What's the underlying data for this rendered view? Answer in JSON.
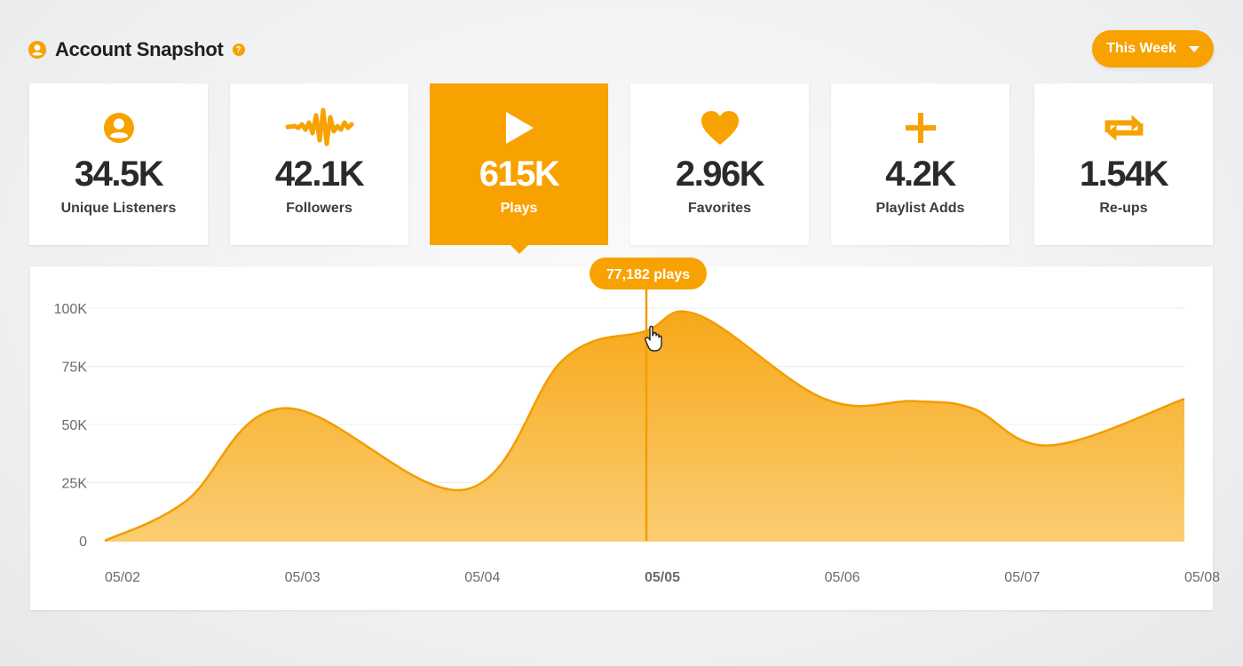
{
  "header": {
    "title": "Account Snapshot",
    "help_icon": "?",
    "icon": "account-circle-icon"
  },
  "period": {
    "label": "This Week",
    "icon": "caret-down-icon"
  },
  "stats": [
    {
      "icon": "user-circle-icon",
      "value": "34.5K",
      "label": "Unique Listeners",
      "active": false
    },
    {
      "icon": "audiomack-wave-icon",
      "value": "42.1K",
      "label": "Followers",
      "active": false
    },
    {
      "icon": "play-icon",
      "value": "615K",
      "label": "Plays",
      "active": true
    },
    {
      "icon": "heart-icon",
      "value": "2.96K",
      "label": "Favorites",
      "active": false
    },
    {
      "icon": "plus-icon",
      "value": "4.2K",
      "label": "Playlist Adds",
      "active": false
    },
    {
      "icon": "repost-icon",
      "value": "1.54K",
      "label": "Re-ups",
      "active": false
    }
  ],
  "colors": {
    "accent": "#f7a200",
    "area_top": "#f7a81a",
    "area_bottom": "#fbcd72",
    "grid": "#ececec"
  },
  "chart_data": {
    "type": "area",
    "categories": [
      "05/02",
      "05/03",
      "05/04",
      "05/05",
      "05/06",
      "05/07",
      "05/08"
    ],
    "y_ticks": [
      "0",
      "25K",
      "50K",
      "75K",
      "100K"
    ],
    "ylim": [
      0,
      100000
    ],
    "series": [
      {
        "values": [
          0,
          57000,
          22000,
          84000,
          61000,
          58000,
          61000
        ],
        "detail_points": [
          [
            0.0,
            0
          ],
          [
            0.45,
            17000
          ],
          [
            1.0,
            57000
          ],
          [
            2.0,
            22000
          ],
          [
            2.55,
            78000
          ],
          [
            3.0,
            90000
          ],
          [
            3.3,
            97000
          ],
          [
            4.0,
            61000
          ],
          [
            4.5,
            60000
          ],
          [
            4.82,
            57000
          ],
          [
            5.25,
            41000
          ],
          [
            6.0,
            61000
          ]
        ]
      }
    ],
    "highlight": {
      "category": "05/05",
      "label": "77,182 plays"
    },
    "grid": true,
    "legend": "none"
  }
}
